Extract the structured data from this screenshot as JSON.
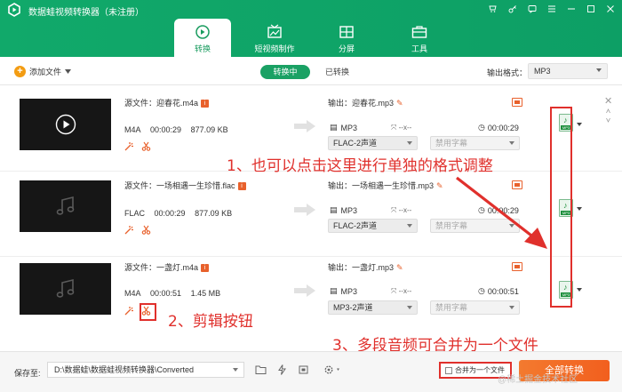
{
  "app": {
    "title": "数据蛙视频转换器（未注册）"
  },
  "nav": {
    "tabs": [
      {
        "label": "转换",
        "icon": "convert-icon"
      },
      {
        "label": "短视频制作",
        "icon": "video-maker-icon"
      },
      {
        "label": "分屏",
        "icon": "split-screen-icon"
      },
      {
        "label": "工具",
        "icon": "toolbox-icon"
      }
    ]
  },
  "toolbar": {
    "add_file": "添加文件",
    "tab_converting": "转换中",
    "tab_converted": "已转换",
    "output_format_label": "输出格式：",
    "output_format_value": "MP3"
  },
  "files": [
    {
      "source": "源文件：迎春花.m4a",
      "format": "M4A",
      "duration": "00:00:29",
      "size": "877.09 KB",
      "output_name": "输出：迎春花.mp3",
      "out_format": "MP3",
      "out_ratio": "--x--",
      "out_duration": "00:00:29",
      "channel": "FLAC-2声道",
      "subtitle": "禁用字幕"
    },
    {
      "source": "源文件：一场相遇一生珍惜.flac",
      "format": "FLAC",
      "duration": "00:00:29",
      "size": "877.09 KB",
      "output_name": "输出：一场相遇一生珍惜.mp3",
      "out_format": "MP3",
      "out_ratio": "--x--",
      "out_duration": "00:00:29",
      "channel": "FLAC-2声道",
      "subtitle": "禁用字幕"
    },
    {
      "source": "源文件：一盏灯.m4a",
      "format": "M4A",
      "duration": "00:00:51",
      "size": "1.45 MB",
      "output_name": "输出：一盏灯.mp3",
      "out_format": "MP3",
      "out_ratio": "--x--",
      "out_duration": "00:00:51",
      "channel": "MP3-2声道",
      "subtitle": "禁用字幕"
    }
  ],
  "annotations": {
    "format_tip": "1、也可以点击这里进行单独的格式调整",
    "cut_tip": "2、剪辑按钮",
    "merge_tip": "3、多段音频可合并为一个文件"
  },
  "footer": {
    "save_label": "保存至:",
    "save_path": "D:\\数据蛙\\数据蛙视频转换器\\Converted",
    "merge_label": "合并为一个文件",
    "convert_all": "全部转换"
  },
  "watermark": "@稀土掘金技术社区",
  "colors": {
    "brand_green": "#11a96a",
    "accent_orange": "#f25f1e",
    "annotation_red": "#e0302c"
  }
}
